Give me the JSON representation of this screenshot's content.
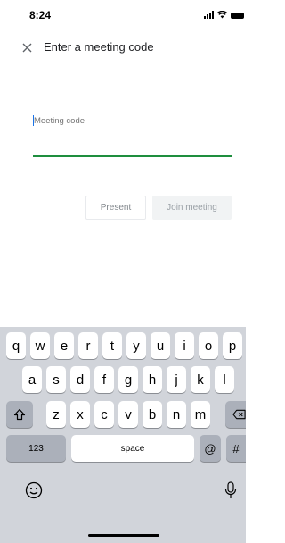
{
  "status_bar": {
    "time": "8:24"
  },
  "header": {
    "title": "Enter a meeting code"
  },
  "form": {
    "input_value": "",
    "placeholder": "Meeting code"
  },
  "buttons": {
    "present": "Present",
    "join": "Join meeting"
  },
  "keyboard": {
    "row1": [
      "q",
      "w",
      "e",
      "r",
      "t",
      "y",
      "u",
      "i",
      "o",
      "p"
    ],
    "row2": [
      "a",
      "s",
      "d",
      "f",
      "g",
      "h",
      "j",
      "k",
      "l"
    ],
    "row3": [
      "z",
      "x",
      "c",
      "v",
      "b",
      "n",
      "m"
    ],
    "numbers_key": "123",
    "space_key": "space",
    "at_key": "@",
    "hash_key": "#"
  },
  "icons": {
    "close": "close-icon",
    "shift": "shift-icon",
    "delete": "backspace-icon",
    "emoji": "emoji-icon",
    "mic": "mic-icon",
    "signal": "signal-icon",
    "wifi": "wifi-icon",
    "battery": "battery-icon"
  },
  "colors": {
    "focus_underline": "#1e8e3e",
    "cursor": "#1a73e8",
    "keyboard_bg": "#d1d4da"
  }
}
